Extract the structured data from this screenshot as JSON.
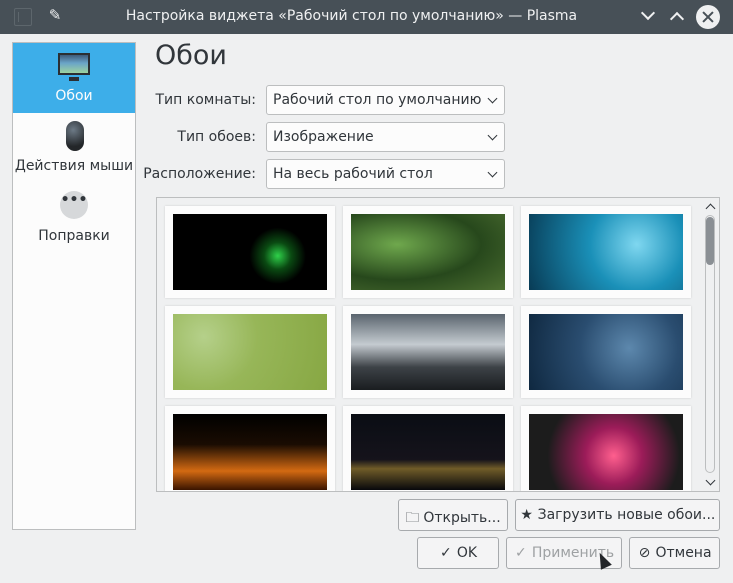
{
  "window": {
    "title": "Настройка виджета «Рабочий стол по умолчанию» — Plasma",
    "controls": [
      "menu-icon",
      "pin-icon",
      "minimize-icon",
      "maximize-icon",
      "close-icon"
    ]
  },
  "sidebar": {
    "items": [
      {
        "label": "Обои",
        "icon": "monitor-icon",
        "active": true
      },
      {
        "label": "Действия мыши",
        "icon": "mouse-icon",
        "active": false
      },
      {
        "label": "Поправки",
        "icon": "more-icon",
        "active": false
      }
    ]
  },
  "main": {
    "title": "Обои",
    "fields": [
      {
        "label": "Тип комнаты:",
        "value": "Рабочий стол по умолчанию"
      },
      {
        "label": "Тип обоев:",
        "value": "Изображение"
      },
      {
        "label": "Расположение:",
        "value": "На весь рабочий стол"
      }
    ]
  },
  "buttons": {
    "open": "Открыть...",
    "download": "Загрузить новые обои...",
    "ok": "OK",
    "apply": "Применить",
    "cancel": "Отмена"
  },
  "colors": {
    "accent": "#3daee9",
    "titlebar": "#475057",
    "background": "#eff0f1"
  }
}
